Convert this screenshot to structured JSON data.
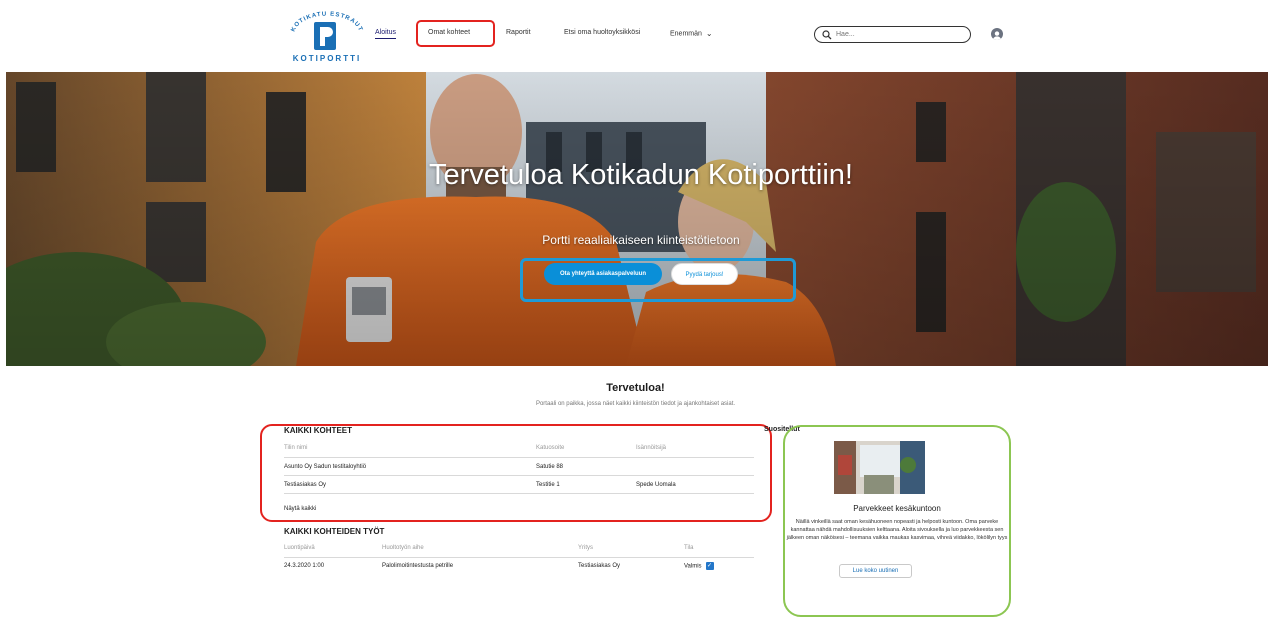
{
  "brand": {
    "logo_arc": "KOTIKATU ESTRAUT",
    "logo_text": "KOTIPORTTI",
    "color": "#1a6fb5"
  },
  "nav": {
    "items": [
      {
        "label": "Aloitus",
        "active": true
      },
      {
        "label": "Omat kohteet",
        "active": false
      },
      {
        "label": "Raportit",
        "active": false
      },
      {
        "label": "Etsi oma huoltoyksikkösi",
        "active": false
      },
      {
        "label": "Enemmän",
        "active": false
      }
    ],
    "chevron_icon": "chevron-down-icon"
  },
  "search": {
    "placeholder": "Hae...",
    "icon": "search-icon"
  },
  "user": {
    "icon": "user-avatar-icon"
  },
  "hero": {
    "title": "Tervetuloa Kotikadun Kotiporttiin!",
    "subtitle": "Portti reaaliaikaiseen kiinteistötietoon",
    "primary_button": "Ota yhteyttä asiakaspalveluun",
    "secondary_button": "Pyydä tarjous!",
    "colors": {
      "primary": "#0a8fd8",
      "workwear": "#ef6a24"
    }
  },
  "welcome": {
    "title": "Tervetuloa!",
    "subtitle": "Portaali on paikka, jossa näet kaikki kiinteistön tiedot ja ajankohtaiset asiat."
  },
  "properties": {
    "title": "KAIKKI KOHTEET",
    "columns": [
      "Tilin nimi",
      "Katuosoite",
      "Isännöitsijä"
    ],
    "rows": [
      {
        "name": "Asunto Oy Sadun testitaloyhtiö",
        "address": "Satutie 88",
        "manager": ""
      },
      {
        "name": "Testiasiakas Oy",
        "address": "Testitie 1",
        "manager": "Spede Uomala"
      }
    ],
    "show_all": "Näytä kaikki"
  },
  "jobs": {
    "title": "KAIKKI KOHTEIDEN TYÖT",
    "columns": [
      "Luontipäivä",
      "Huoltotyön aihe",
      "Yritys",
      "Tila"
    ],
    "rows": [
      {
        "date": "24.3.2020 1:00",
        "subject": "Palolimoitintestusta petrille",
        "company": "Testiasiakas Oy",
        "status": "Valmis",
        "checked": true
      }
    ]
  },
  "recommended": {
    "label": "Suositellut",
    "article_title": "Parvekkeet kesäkuntoon",
    "article_body": "Näillä vinkeillä saat oman kesähuoneen nopeasti ja helposti kuntoon. Oma parveke kannattaa nähdä mahdollisuuksien kelttaana. Aloita sivouksella ja luo parvekkeesta sen jälkeen oman näköisesi – teemana vaikka maukas kasvimaa, vihreä viidakko, lökölilyn tyys",
    "button": "Lue koko uutinen"
  }
}
